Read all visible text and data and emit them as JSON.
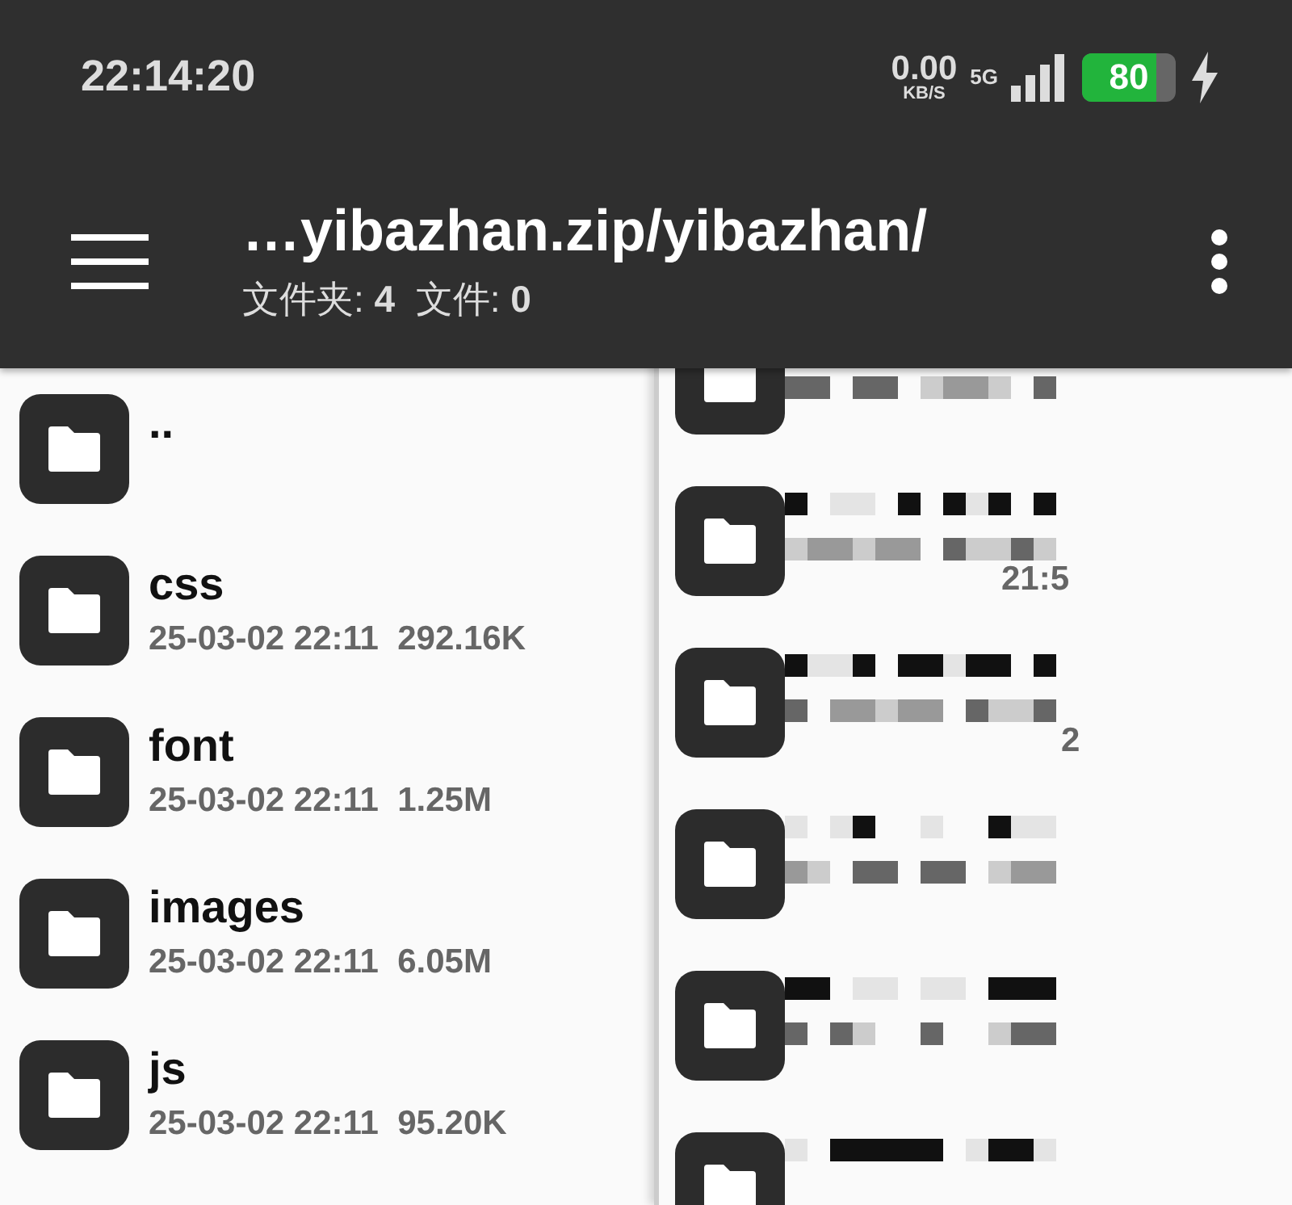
{
  "status_bar": {
    "time": "22:14:20",
    "net_speed": "0.00",
    "net_unit": "KB/S",
    "network": "5G",
    "battery": {
      "text": "80",
      "level": 0.8
    },
    "charging": true
  },
  "toolbar": {
    "title": "…yibazhan.zip/yibazhan/",
    "subtitle": "文件夹: **4**  文件: **0**"
  },
  "left_list": [
    {
      "name": ".."
    },
    {
      "name": "css",
      "meta": "25-03-02 22:11  292.16K"
    },
    {
      "name": "font",
      "meta": "25-03-02 22:11  1.25M"
    },
    {
      "name": "images",
      "meta": "25-03-02 22:11  6.05M"
    },
    {
      "name": "js",
      "meta": "25-03-02 22:11  95.20K"
    }
  ],
  "right_list": [
    {
      "kind": "obscured"
    },
    {
      "kind": "obscured",
      "fragment": "21:5"
    },
    {
      "kind": "obscured",
      "fragment": "2"
    },
    {
      "kind": "obscured"
    },
    {
      "kind": "obscured"
    },
    {
      "kind": "obscured"
    }
  ]
}
